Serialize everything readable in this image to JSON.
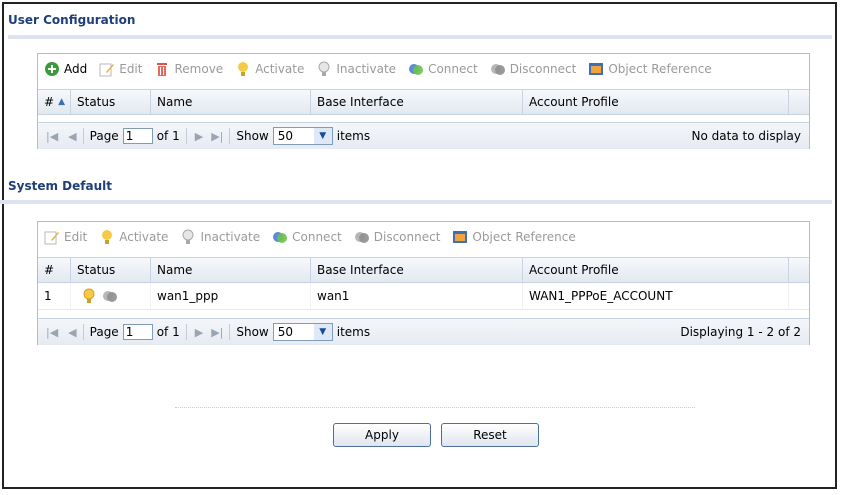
{
  "user_config": {
    "title": "User Configuration",
    "toolbar": {
      "add": "Add",
      "edit": "Edit",
      "remove": "Remove",
      "activate": "Activate",
      "inactivate": "Inactivate",
      "connect": "Connect",
      "disconnect": "Disconnect",
      "object_reference": "Object Reference"
    },
    "columns": {
      "num": "#",
      "status": "Status",
      "name": "Name",
      "base_interface": "Base Interface",
      "account_profile": "Account Profile"
    },
    "pager": {
      "page_label": "Page",
      "page_value": "1",
      "of_label": "of 1",
      "show_label": "Show",
      "show_value": "50",
      "items_label": "items",
      "status_text": "No data to display"
    }
  },
  "system_default": {
    "title": "System Default",
    "toolbar": {
      "edit": "Edit",
      "activate": "Activate",
      "inactivate": "Inactivate",
      "connect": "Connect",
      "disconnect": "Disconnect",
      "object_reference": "Object Reference"
    },
    "columns": {
      "num": "#",
      "status": "Status",
      "name": "Name",
      "base_interface": "Base Interface",
      "account_profile": "Account Profile"
    },
    "rows": [
      {
        "num": "1",
        "status_icons": [
          "lightbulb-on-icon",
          "connection-icon"
        ],
        "name": "wan1_ppp",
        "base_interface": "wan1",
        "account_profile": "WAN1_PPPoE_ACCOUNT"
      }
    ],
    "pager": {
      "page_label": "Page",
      "page_value": "1",
      "of_label": "of 1",
      "show_label": "Show",
      "show_value": "50",
      "items_label": "items",
      "status_text": "Displaying 1 - 2 of 2"
    }
  },
  "actions": {
    "apply": "Apply",
    "reset": "Reset"
  },
  "colors": {
    "section_title": "#1f3f7a",
    "disabled_text": "#9a9a9a"
  }
}
